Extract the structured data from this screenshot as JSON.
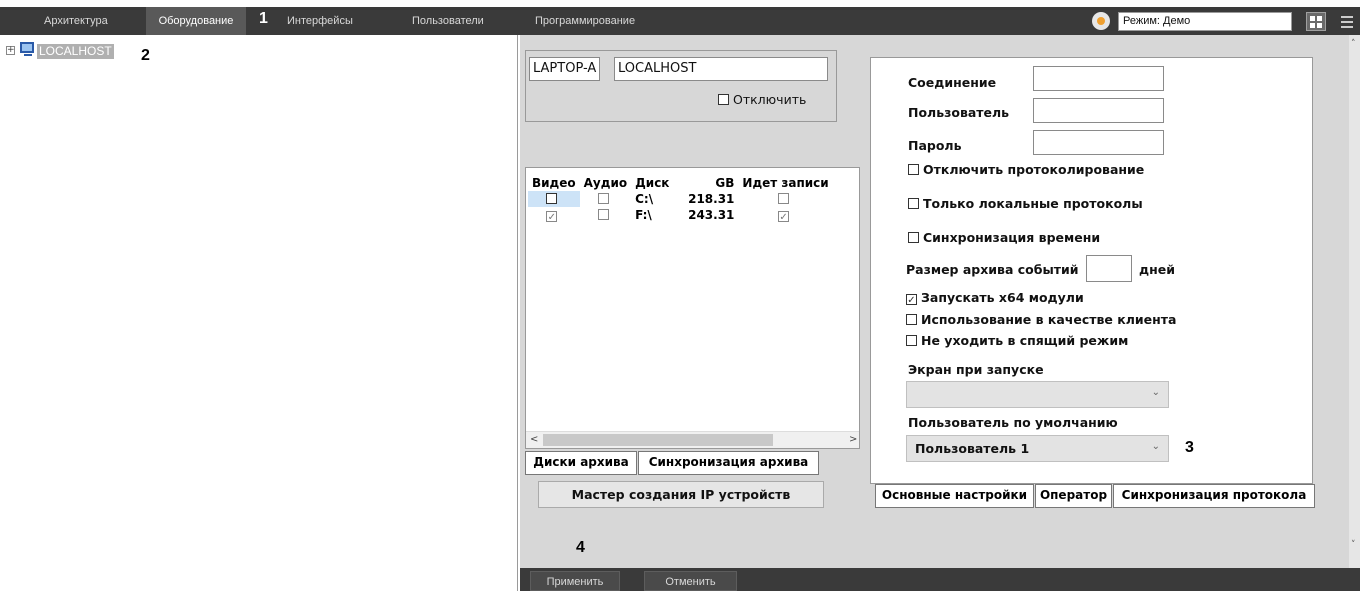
{
  "menu": {
    "items": [
      "Архитектура",
      "Оборудование",
      "Интерфейсы",
      "Пользователи",
      "Программирование"
    ],
    "mode_label": "Режим: Демо"
  },
  "callouts": {
    "c1": "1",
    "c2": "2",
    "c3": "3",
    "c4": "4"
  },
  "tree": {
    "root_label": "LOCALHOST"
  },
  "server": {
    "name_short": "LAPTOP-A",
    "host": "LOCALHOST",
    "disable_label": "Отключить"
  },
  "disks": {
    "columns": [
      "Видео",
      "Аудио",
      "Диск",
      "GB",
      "Идет записи"
    ],
    "rows": [
      {
        "video": false,
        "audio": false,
        "disk": "C:\\",
        "gb": "218.31",
        "recording": false
      },
      {
        "video": true,
        "audio": false,
        "disk": "F:\\",
        "gb": "243.31",
        "recording": true
      }
    ],
    "tabs": [
      "Диски архива",
      "Синхронизация архива"
    ],
    "wizard_button": "Мастер создания IP устройств"
  },
  "settings": {
    "connection_label": "Соединение",
    "user_label": "Пользователь",
    "password_label": "Пароль",
    "disable_logging": "Отключить протоколирование",
    "local_logs_only": "Только локальные протоколы",
    "time_sync": "Синхронизация времени",
    "event_archive_size": "Размер архива событий",
    "days": "дней",
    "run_x64": "Запускать x64 модули",
    "use_as_client": "Использование в качестве клиента",
    "no_sleep": "Не уходить в спящий режим",
    "startup_screen_label": "Экран при запуске",
    "startup_screen_value": "",
    "default_user_label": "Пользователь по умолчанию",
    "default_user_value": "Пользователь 1",
    "tabs": [
      "Основные настройки",
      "Оператор",
      "Синхронизация протокола"
    ]
  },
  "footer": {
    "apply": "Применить",
    "cancel": "Отменить"
  },
  "colors": {
    "menubar": "#3a3a3a",
    "active_tab": "#595959",
    "panel": "#d7d7d7",
    "tree_selected": "#b0b0b0"
  }
}
